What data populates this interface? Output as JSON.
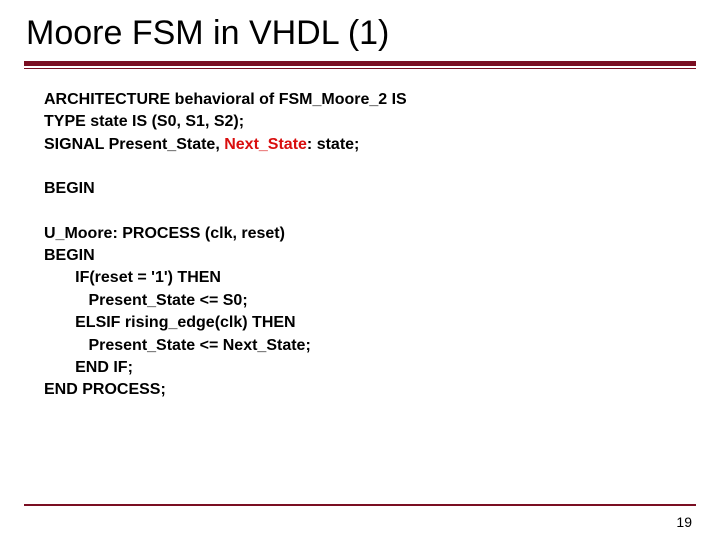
{
  "title": "Moore FSM in VHDL (1)",
  "code": {
    "l1_a": "ARCHITECTURE behavioral of FSM_Moore_2 IS",
    "l2_a": "TYPE state IS (S0, S1, S2);",
    "l3_a": "SIGNAL Present_State, ",
    "l3_hl": "Next_State",
    "l3_b": ": state;",
    "l4_a": "BEGIN",
    "l5_a": "U_Moore: PROCESS (clk, reset)",
    "l6_a": "BEGIN",
    "l7_a": "       IF(reset = '1') THEN",
    "l8_a": "          Present_State <= S0;",
    "l9_a": "       ELSIF rising_edge(clk) THEN",
    "l10_a": "          Present_State <= Next_State;",
    "l11_a": "       END IF;",
    "l12_a": "END PROCESS;"
  },
  "page_number": "19"
}
